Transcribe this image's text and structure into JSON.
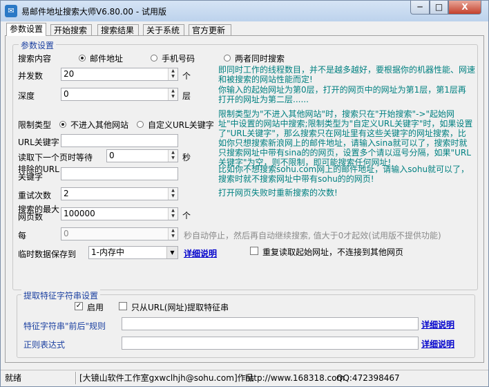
{
  "window": {
    "title": "易邮件地址搜索大师V6.80.00 - 试用版",
    "app_icon": "mail-icon",
    "min": "─",
    "max": "□",
    "close": "X"
  },
  "tabs": [
    "参数设置",
    "开始搜索",
    "搜索结果",
    "关于系统",
    "官方更新"
  ],
  "params": {
    "group_title": "参数设置",
    "search_content": {
      "label": "搜索内容",
      "options": [
        "邮件地址",
        "手机号码",
        "两者同时搜索"
      ],
      "selected": 0
    },
    "concurrency": {
      "label": "并发数",
      "value": "20",
      "unit": "个"
    },
    "depth": {
      "label": "深度",
      "value": "0",
      "unit": "层"
    },
    "note_concurrency": "即同时工作的线程数目，并不是越多越好，要根据你的机器性能、网速和被搜索的网站性能而定!",
    "note_depth": "你输入的起始网址为第0层，打开的网页中的网址为第1层，第1层再打开的网址为第二层......",
    "limit_type": {
      "label": "限制类型",
      "options": [
        "不进入其他网站",
        "自定义URL关键字"
      ],
      "selected": 0
    },
    "url_keyword": {
      "label": "URL关键字",
      "value": ""
    },
    "wait": {
      "label": "读取下一个页时等待",
      "value": "0",
      "unit": "秒"
    },
    "exclude_url": {
      "label": "排除的URL关键字",
      "value": ""
    },
    "note_limit": "限制类型为\"不进入其他网站\"时，搜索只在\"开始搜索\"->\"起始网址\"中设置的网站中搜索;限制类型为\"自定义URL关键字\"时，如果设置了\"URL关键字\"，那么搜索只在网址里有这些关键字的网址搜索，比如你只想搜索新浪网上的邮件地址，请输入sina就可以了，搜索时就只搜索网址中带有sina的的网页，设置多个请以逗号分隔，如果\"URL关键字\"为空，则不限制，即可能搜索任何网址!",
    "note_exclude": "比如你不想搜索sohu.com网上的邮件地址，请输入sohu就可以了，搜索时就不搜索网址中带有sohu的的网页!",
    "retry": {
      "label": "重试次数",
      "value": "2"
    },
    "note_retry": "打开网页失败时重新搜索的次数!",
    "max_results": {
      "label": "搜索的最大网页数",
      "value": "100000",
      "unit": "个"
    },
    "every": {
      "label": "每",
      "value": "0",
      "note": "秒自动停止，然后再自动继续搜索, 值大于0才起效(试用版不提供功能)"
    },
    "temp_save": {
      "label": "临时数据保存到",
      "value": "1-内存中",
      "link": "详细说明"
    },
    "reread": {
      "label": "重复读取起始网址，不连接到其他网页",
      "checked": false
    }
  },
  "extract": {
    "group_title": "提取特征字符串设置",
    "enable": {
      "label": "启用",
      "checked": true
    },
    "url_only": {
      "label": "只从URL(网址)提取特征串",
      "checked": false
    },
    "rule": {
      "label": "特征字符串\"前后\"规则",
      "value": "",
      "link": "详细说明"
    },
    "regex": {
      "label": "正则表达式",
      "value": "",
      "link": "详细说明"
    }
  },
  "status": {
    "state": "就绪",
    "company": "[大镜山软件工作室gxwclhjh@sohu.com]作品",
    "url": "http://www.168318.com",
    "qq": "QQ:472398467"
  }
}
